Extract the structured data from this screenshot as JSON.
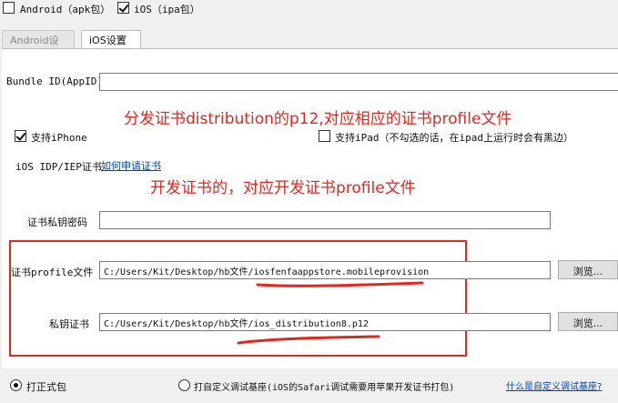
{
  "top_options": {
    "android_label": "Android（apk包）",
    "android_checked": false,
    "ios_label": "iOS（ipa包）",
    "ios_checked": true
  },
  "tabs": [
    {
      "label": "Android设置",
      "active": false
    },
    {
      "label": "iOS设置",
      "active": true
    }
  ],
  "form": {
    "bundle_id_label": "Bundle ID(AppID)",
    "bundle_id_value": "",
    "support_iphone_label": "支持iPhone",
    "support_iphone_checked": true,
    "support_ipad_label": "支持iPad（不勾选的话，在ipad上运行时会有黑边）",
    "support_ipad_checked": false,
    "cert_label": "iOS IDP/IEP证书",
    "cert_link": "如何申请证书",
    "private_key_password_label": "证书私钥密码",
    "private_key_password_value": "",
    "profile_label": "证书profile文件",
    "profile_value": "C:/Users/Kit/Desktop/hb文件/iosfenfaappstore.mobileprovision",
    "private_key_label": "私钥证书",
    "private_key_value": "C:/Users/Kit/Desktop/hb文件/ios_distribution8.p12",
    "browse_label": "浏览..."
  },
  "annotations": {
    "distribution_note": "分发证书distribution的p12,对应相应的证书profile文件",
    "development_note": "开发证书的，对应开发证书profile文件",
    "color": "#e5261e"
  },
  "bottom_options": {
    "formal_label": "打正式包",
    "formal_selected": true,
    "custom_label": "打自定义调试基座(iOS的Safari调试需要用苹果开发证书打包)",
    "custom_selected": false,
    "custom_link": "什么是自定义调试基座?"
  }
}
